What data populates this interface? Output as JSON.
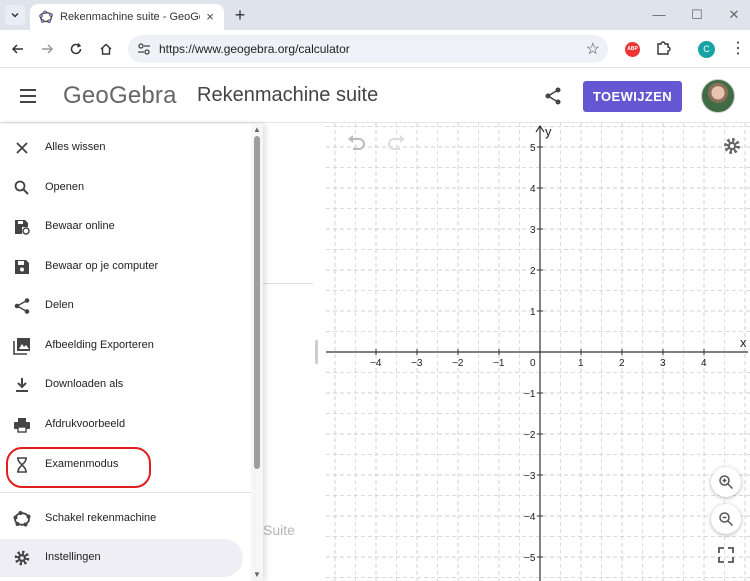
{
  "browser": {
    "tab_title": "Rekenmachine suite - GeoGebra",
    "tab_close": "×",
    "new_tab": "+",
    "url": "https://www.geogebra.org/calculator",
    "abp_label": "ABP",
    "profile_initial": "C",
    "window_controls": {
      "minimize": "—",
      "maximize": "☐",
      "close": "✕"
    }
  },
  "header": {
    "logo": "GeoGebra",
    "title": "Rekenmachine suite",
    "assign_button": "TOEWIJZEN"
  },
  "menu": {
    "items": [
      {
        "label": "Alles wissen",
        "icon": "close-icon"
      },
      {
        "label": "Openen",
        "icon": "search-icon"
      },
      {
        "label": "Bewaar online",
        "icon": "cloud-save-icon"
      },
      {
        "label": "Bewaar op je computer",
        "icon": "save-icon"
      },
      {
        "label": "Delen",
        "icon": "share-icon"
      },
      {
        "label": "Afbeelding Exporteren",
        "icon": "image-icon"
      },
      {
        "label": "Downloaden als",
        "icon": "download-icon"
      },
      {
        "label": "Afdrukvoorbeeld",
        "icon": "print-icon"
      },
      {
        "label": "Examenmodus",
        "icon": "hourglass-icon"
      },
      {
        "label": "Schakel rekenmachine",
        "icon": "geogebra-icon"
      },
      {
        "label": "Instellingen",
        "icon": "gear-icon"
      }
    ]
  },
  "algebra": {
    "suite_text": "Suite"
  },
  "graph": {
    "x_axis_label": "x",
    "y_axis_label": "y",
    "x_ticks": [
      -4,
      -3,
      -2,
      -1,
      0,
      1,
      2,
      3,
      4
    ],
    "y_ticks": [
      -5,
      -4,
      -3,
      -2,
      -1,
      1,
      2,
      3,
      4,
      5
    ],
    "x_range": [
      -5,
      5
    ],
    "y_range": [
      -5.5,
      5.5
    ],
    "grid": true
  },
  "colors": {
    "accent": "#6557d2",
    "highlight": "#e01e1e",
    "axis": "#333333",
    "grid": "#d0d0d0"
  }
}
